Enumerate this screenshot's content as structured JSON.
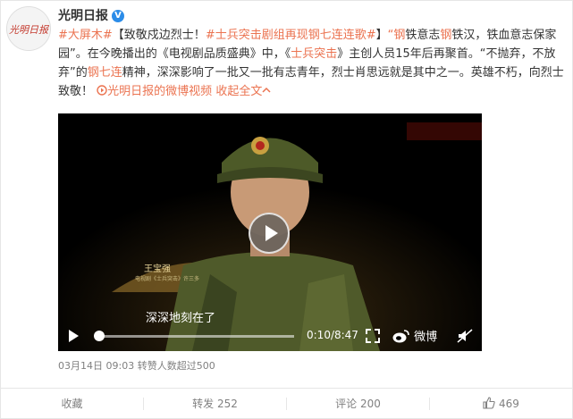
{
  "user": {
    "name": "光明日报",
    "verified_mark": "V",
    "avatar_text": "光明日报"
  },
  "post": {
    "tag1": "#大屏木#",
    "seg1": "【致敬戍边烈士！",
    "tag2": "#士兵突击剧组再现钢七连连歌#",
    "seg2": "】",
    "q1": "“",
    "r1": "钢",
    "seg3": "铁意志",
    "r2": "钢",
    "seg4": "铁汉，铁血意志保家园”。在今晚播出的《电视剧品质盛典》中，《",
    "r3": "士兵突击",
    "seg5": "》主创人员15年后再聚首。“不抛弃，不放弃”的",
    "r4": "钢七连",
    "seg6": "精神，深深影响了一批又一批有志青年，烈士肖思远就是其中之一。英雄不朽，向烈士致敬！",
    "video_link": "光明日报的微博视频",
    "expand": "收起全文",
    "expand_icon": "chevron-up-icon"
  },
  "video": {
    "subtitle": "深深地刻在了",
    "name_plate": "王宝强",
    "name_plate_sub": "电视剧《士兵突击》许三多",
    "time": "0:10/8:47",
    "progress": 0.019,
    "logo": "微博",
    "icons": [
      "play-icon",
      "fullscreen-icon",
      "weibo-logo-icon",
      "mute-icon"
    ]
  },
  "meta": {
    "date": "03月14日 09:03",
    "reposts_note": "转赞人数超过500"
  },
  "actions": {
    "favorite": "收藏",
    "repost": "转发 252",
    "comment": "评论 200",
    "like_icon": "thumbs-up-icon",
    "like_count": "469"
  },
  "colors": {
    "link": "#eb7350",
    "text": "#333333",
    "meta": "#808080",
    "verified": "#2b8ce8"
  }
}
